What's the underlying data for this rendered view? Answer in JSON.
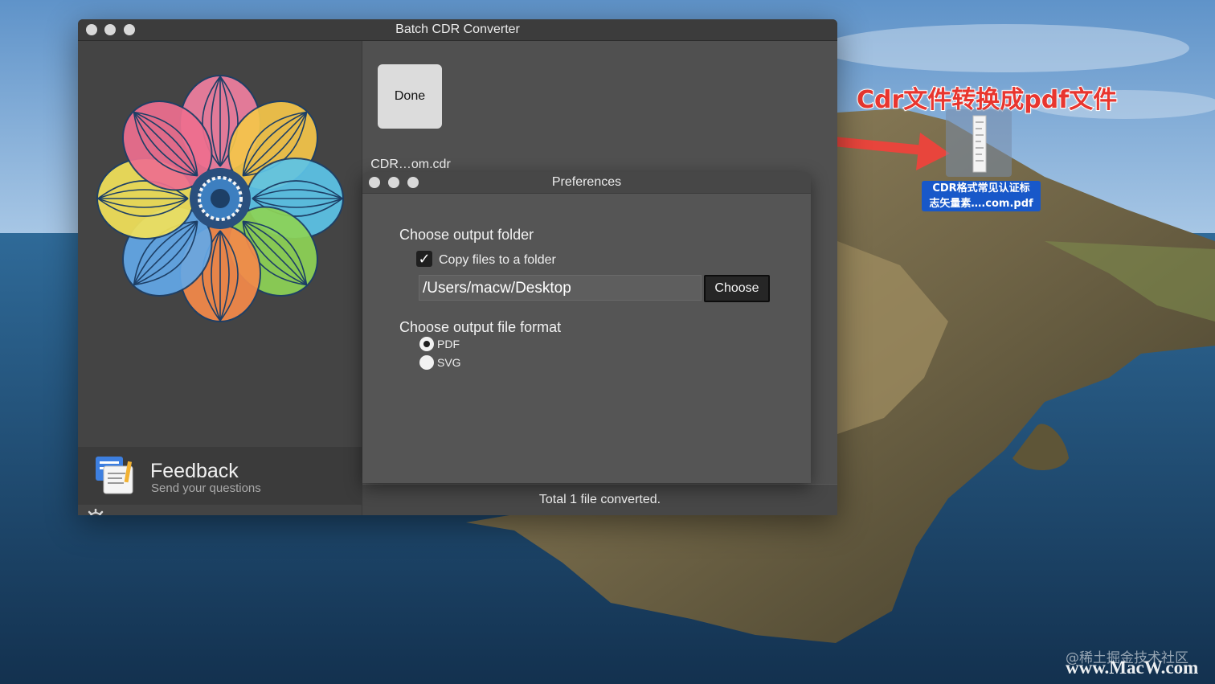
{
  "main_window": {
    "title": "Batch CDR Converter",
    "file": {
      "thumb_label": "Done",
      "name": "CDR…om.cdr"
    },
    "feedback": {
      "title": "Feedback",
      "subtitle": "Send your questions"
    },
    "status": "Total 1 file converted."
  },
  "preferences": {
    "title": "Preferences",
    "output_folder_title": "Choose output folder",
    "copy_checkbox": {
      "label": "Copy files to a folder",
      "checked": true
    },
    "path_value": "/Users/macw/Desktop",
    "choose_button": "Choose",
    "format_title": "Choose output file format",
    "formats": [
      {
        "label": "PDF",
        "selected": true
      },
      {
        "label": "SVG",
        "selected": false
      }
    ]
  },
  "desktop": {
    "annotation": "Cdr文件转换成pdf文件",
    "pdf_file_label_line1": "CDR格式常见认证标",
    "pdf_file_label_line2": "志矢量素….com.pdf",
    "watermark_top": "@稀土掘金技术社区",
    "watermark_bottom": "www.MacW.com"
  },
  "colors": {
    "arrow": "#e8453c",
    "selection": "#1858c9"
  },
  "icons": [
    "close-dot",
    "minimize-dot",
    "zoom-dot",
    "flower-logo",
    "feedback-icon",
    "gear-icon",
    "pdf-document-icon",
    "arrow"
  ]
}
